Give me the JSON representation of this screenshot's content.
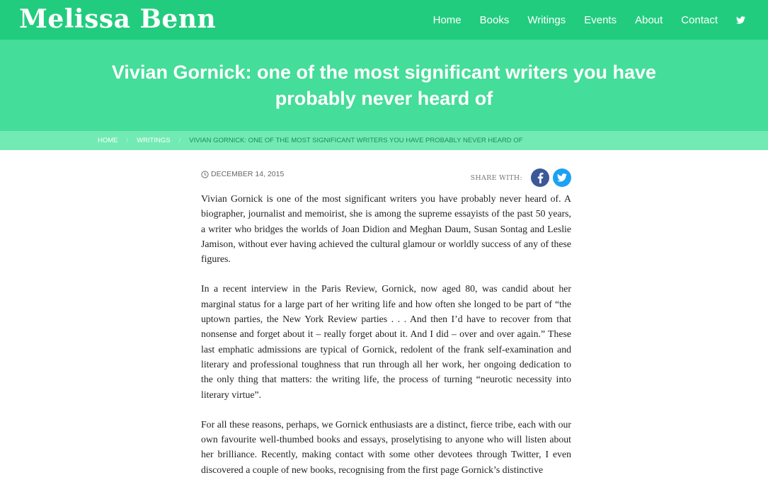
{
  "site": {
    "title": "Melissa Benn"
  },
  "nav": {
    "items": [
      "Home",
      "Books",
      "Writings",
      "Events",
      "About",
      "Contact"
    ],
    "twitter_icon": "twitter-icon"
  },
  "colors": {
    "header_bg": "#22cc7e",
    "hero_bg": "#44dd99",
    "breadcrumb_bg": "#72eab4",
    "facebook": "#3b5998",
    "twitter": "#1da1f2"
  },
  "article": {
    "title": "Vivian Gornick: one of the most significant writers you have probably never heard of",
    "date": "DECEMBER 14, 2015",
    "share_label": "SHARE WITH:",
    "paragraphs": [
      "Vivian Gornick is one of the most significant writers you have probably never heard of. A biographer, journalist and memoirist, she is among the supreme essayists of the past 50 years, a writer who bridges the worlds of Joan Didion and Meghan Daum, Susan Sontag and Leslie Jamison, without ever having achieved the cultural glamour or worldly success of any of these figures.",
      "In a recent interview in the Paris Review, Gornick, now aged 80, was candid about her marginal status for a large part of her writing life and how often she longed to be part of “the uptown parties, the New York Review parties . . . And then I’d have to recover from that nonsense and forget about it – really forget about it. And I did – over and over again.” These last emphatic admissions are typical of Gornick, redolent of the frank self-examination and literary and professional toughness that run through all her work, her ongoing dedication to the only thing that matters: the writing life, the process of turning “neurotic necessity into literary virtue”.",
      "For all these reasons, perhaps, we Gornick enthusiasts are a distinct, fierce tribe, each with our own favourite well-thumbed books and essays, proselytising to anyone who will listen about her brilliance. Recently, making contact with some other devotees through Twitter, I even discovered a couple of new books, recognising from the first page Gornick’s distinctive"
    ]
  },
  "breadcrumb": {
    "home": "HOME",
    "sep": "/",
    "writings": "WRITINGS",
    "current": "VIVIAN GORNICK: ONE OF THE MOST SIGNIFICANT WRITERS YOU HAVE PROBABLY NEVER HEARD OF"
  }
}
